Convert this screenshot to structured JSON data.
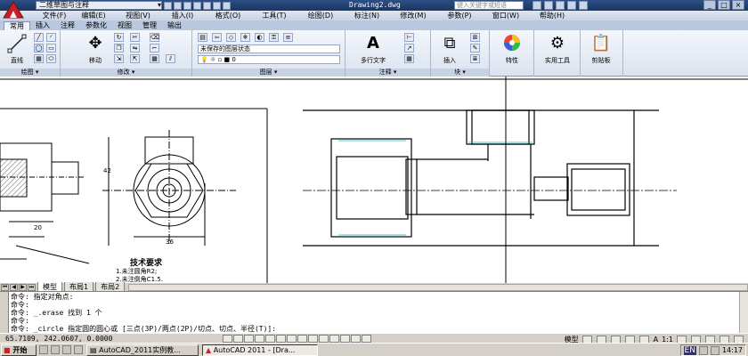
{
  "window": {
    "title": "Drawing2.dwg",
    "workspace": "二维草图与注释",
    "search_placeholder": "键入关键字或短语"
  },
  "menu": [
    "文件(F)",
    "编辑(E)",
    "视图(V)",
    "插入(I)",
    "格式(O)",
    "工具(T)",
    "绘图(D)",
    "标注(N)",
    "修改(M)",
    "参数(P)",
    "窗口(W)",
    "帮助(H)"
  ],
  "ribbon_tabs": [
    "常用",
    "插入",
    "注释",
    "参数化",
    "视图",
    "管理",
    "输出"
  ],
  "ribbon": {
    "line_label": "直线",
    "move_label": "移动",
    "layer_state": "未保存的图层状态",
    "layer_current": "0",
    "mtext_label": "多行文字",
    "insert_label": "插入",
    "properties_label": "特性",
    "utilities_label": "实用工具",
    "clipboard_label": "剪贴板",
    "panels": {
      "draw": "绘图",
      "modify": "修改",
      "layers": "图层",
      "annotation": "注释",
      "block": "块"
    }
  },
  "drawing": {
    "dim_20": "20",
    "dim_36": "36",
    "dim_42": "42",
    "tech_title": "技术要求",
    "tech_1": "1.未注圆角R2;",
    "tech_2": "2.未注倒角C1.5."
  },
  "layout_tabs": [
    "模型",
    "布局1",
    "布局2"
  ],
  "command_lines": [
    "命令: 指定对角点:",
    "命令:",
    "命令: _.erase 找到 1 个",
    "命令:",
    "命令: _circle 指定圆的圆心或 [三点(3P)/两点(2P)/切点、切点、半径(T)]:"
  ],
  "status": {
    "coords": "65.7109, 242.0607, 0.0000",
    "model_label": "模型",
    "scale": "1:1"
  },
  "taskbar": {
    "start": "开始",
    "tasks": [
      "AutoCAD_2011实例教...",
      "AutoCAD 2011 - [Dra..."
    ],
    "lang": "EN",
    "clock": "14:17"
  }
}
